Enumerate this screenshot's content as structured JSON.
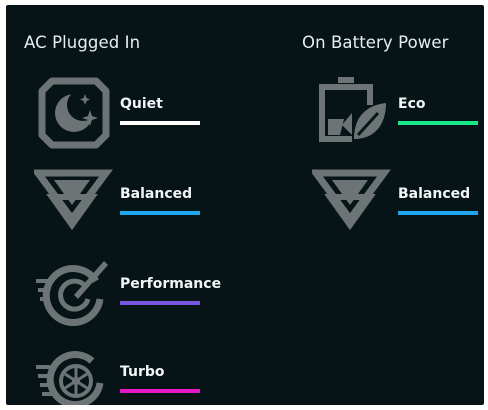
{
  "ac": {
    "title": "AC Plugged In",
    "modes": [
      {
        "label": "Quiet",
        "color": "#ffffff",
        "icon": "quiet-moon-icon"
      },
      {
        "label": "Balanced",
        "color": "#1ea7ec",
        "icon": "balanced-chevron-icon"
      },
      {
        "label": "Performance",
        "color": "#7a56e0",
        "icon": "performance-gauge-icon"
      },
      {
        "label": "Turbo",
        "color": "#e918c9",
        "icon": "turbo-fan-icon"
      }
    ]
  },
  "battery": {
    "title": "On Battery Power",
    "modes": [
      {
        "label": "Eco",
        "color": "#19e88a",
        "icon": "eco-battery-leaf-icon"
      },
      {
        "label": "Balanced",
        "color": "#1ea7ec",
        "icon": "balanced-chevron-icon"
      }
    ]
  },
  "colors": {
    "background": "#061417",
    "icon": "#6d7475",
    "text": "#f2f5f6"
  }
}
